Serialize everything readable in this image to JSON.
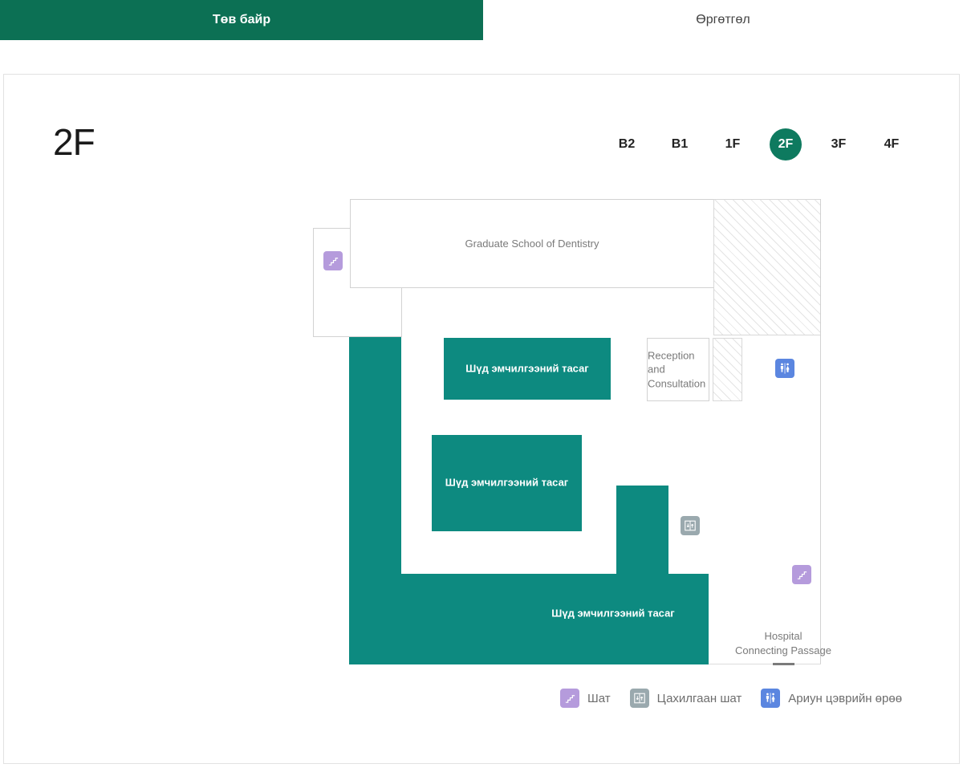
{
  "tabs": [
    {
      "label": "Төв байр",
      "active": true
    },
    {
      "label": "Өргөтгөл",
      "active": false
    }
  ],
  "floor": {
    "title": "2F",
    "options": [
      "B2",
      "B1",
      "1F",
      "2F",
      "3F",
      "4F"
    ],
    "selected": "2F"
  },
  "colors": {
    "tab_active": "#0c7054",
    "floor_selected": "#0e7a5f",
    "room_teal": "#0d8a80",
    "icon_stairs": "#b59bdc",
    "icon_elevator": "#9aa9ae",
    "icon_restroom": "#5b86e0"
  },
  "map": {
    "rooms": [
      {
        "id": "graduate-school",
        "label": "Graduate School of Dentistry",
        "style": "outline"
      },
      {
        "id": "dental-dept-1",
        "label": "Шүд эмчилгээний тасаг",
        "style": "teal"
      },
      {
        "id": "dental-dept-2",
        "label": "Шүд эмчилгээний тасаг",
        "style": "teal"
      },
      {
        "id": "dental-dept-3",
        "label": "Шүд эмчилгээний тасаг",
        "style": "teal"
      },
      {
        "id": "reception",
        "label": "Reception and Consultation",
        "style": "outline"
      },
      {
        "id": "hospital-passage",
        "label": "Hospital\nConnecting Passage",
        "style": "plain"
      }
    ],
    "reception_line1": "Reception and",
    "reception_line2": "Consultation",
    "passage_line1": "Hospital",
    "passage_line2": "Connecting Passage",
    "graduate_label": "Graduate School of Dentistry",
    "dental_label": "Шүд эмчилгээний тасаг"
  },
  "legend": [
    {
      "icon": "stairs-icon",
      "label": "Шат"
    },
    {
      "icon": "elevator-icon",
      "label": "Цахилгаан шат"
    },
    {
      "icon": "restroom-icon",
      "label": "Ариун цэврийн өрөө"
    }
  ]
}
